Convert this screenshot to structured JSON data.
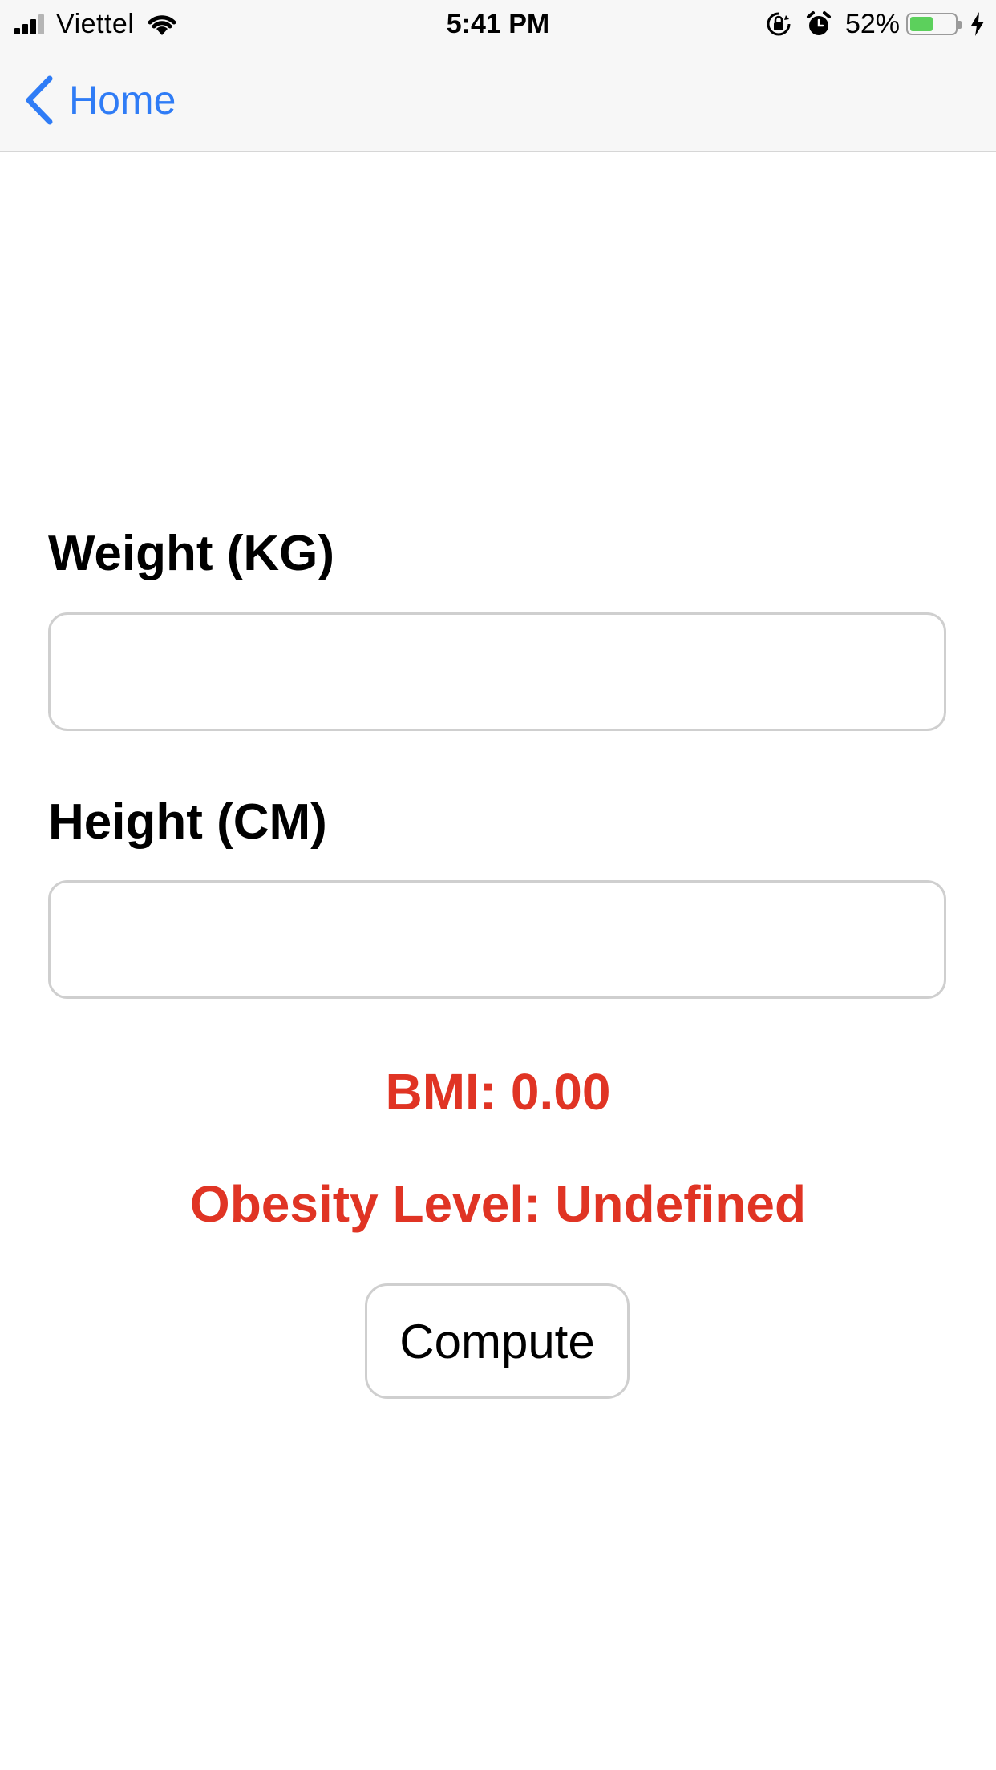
{
  "status_bar": {
    "carrier": "Viettel",
    "time": "5:41 PM",
    "battery_percent": "52%",
    "battery_level": 0.52,
    "icons": [
      "signal-icon",
      "wifi-icon",
      "rotation-lock-icon",
      "alarm-icon",
      "battery-icon",
      "charging-bolt-icon"
    ]
  },
  "nav": {
    "back_label": "Home",
    "back_icon": "chevron-left-icon",
    "accent_color": "#2f7cf6"
  },
  "form": {
    "weight_label": "Weight (KG)",
    "weight_value": "",
    "height_label": "Height (CM)",
    "height_value": ""
  },
  "results": {
    "bmi_text": "BMI: 0.00",
    "obesity_text": "Obesity Level: Undefined",
    "color": "#e03424"
  },
  "compute_label": "Compute"
}
